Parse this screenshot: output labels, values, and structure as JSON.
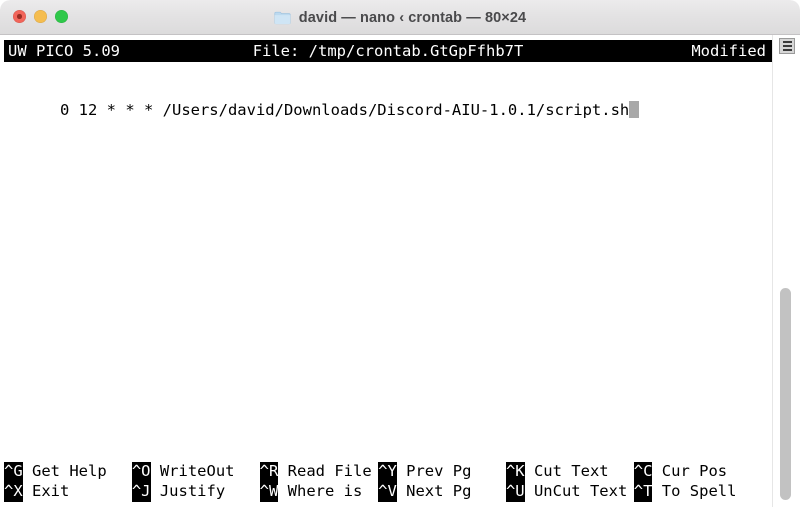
{
  "window": {
    "title": "david — nano ‹ crontab — 80×24",
    "folder_icon": "folder-icon",
    "traffic_lights": [
      {
        "name": "close",
        "label": "Close",
        "color": "#f2655a"
      },
      {
        "name": "minimize",
        "label": "Minimize",
        "color": "#f5bd4f"
      },
      {
        "name": "zoom",
        "label": "Zoom",
        "color": "#2fc84a"
      }
    ]
  },
  "editor": {
    "header": {
      "app": "UW PICO 5.09",
      "file": "File: /tmp/crontab.GtGpFfhb7T",
      "status": "Modified"
    },
    "lines": [
      "0 12 * * * /Users/david/Downloads/Discord-AIU-1.0.1/script.sh"
    ],
    "cursor": {
      "visible": true,
      "color": "#a8a8a8"
    },
    "shortcuts_row1": [
      {
        "key": "^G",
        "label": " Get Help"
      },
      {
        "key": "^O",
        "label": " WriteOut"
      },
      {
        "key": "^R",
        "label": " Read File"
      },
      {
        "key": "^Y",
        "label": " Prev Pg"
      },
      {
        "key": "^K",
        "label": " Cut Text"
      },
      {
        "key": "^C",
        "label": " Cur Pos"
      }
    ],
    "shortcuts_row2": [
      {
        "key": "^X",
        "label": " Exit"
      },
      {
        "key": "^J",
        "label": " Justify"
      },
      {
        "key": "^W",
        "label": " Where is"
      },
      {
        "key": "^V",
        "label": " Next Pg"
      },
      {
        "key": "^U",
        "label": " UnCut Text"
      },
      {
        "key": "^T",
        "label": " To Spell"
      }
    ]
  },
  "scrollbar": {
    "marker_icon": "scroll-lines-icon",
    "thumb_name": "scrollbar-thumb"
  },
  "colors": {
    "terminal_bg": "#ffffff",
    "terminal_fg": "#000000",
    "inverse_bg": "#000000",
    "inverse_fg": "#ffffff",
    "titlebar_bg": "#e8e7e8"
  }
}
